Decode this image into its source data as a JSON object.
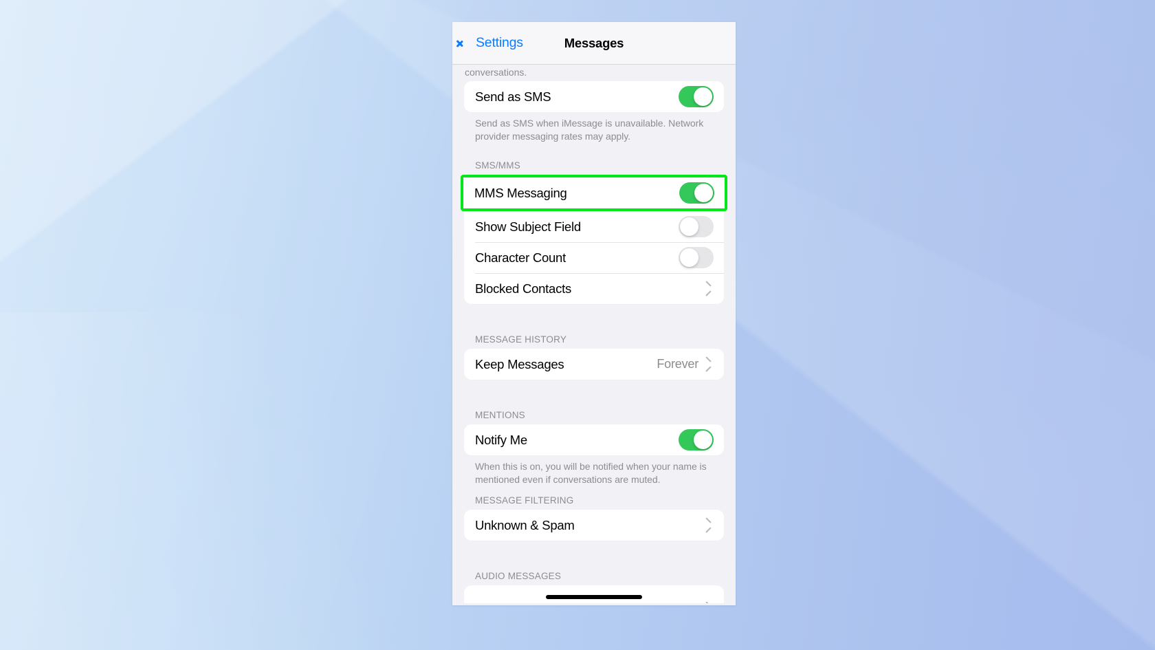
{
  "wallpaper": {
    "color_left": "#c6dff7",
    "color_right": "#a6bced"
  },
  "navbar": {
    "back_label": "Settings",
    "title": "Messages",
    "back_icon": "chevron-left-icon",
    "accent_color": "#0a7cff"
  },
  "clipped_text": "conversations.",
  "highlight": {
    "color": "#00e817",
    "target": "MMS Messaging"
  },
  "sections": [
    {
      "header": "",
      "rows": [
        {
          "label": "Send as SMS",
          "control": "toggle",
          "state": "on"
        }
      ],
      "footnote": "Send as SMS when iMessage is unavailable. Network provider messaging rates may apply."
    },
    {
      "header": "SMS/MMS",
      "rows": [
        {
          "label": "MMS Messaging",
          "control": "toggle",
          "state": "on",
          "highlighted": true
        },
        {
          "label": "Show Subject Field",
          "control": "toggle",
          "state": "off"
        },
        {
          "label": "Character Count",
          "control": "toggle",
          "state": "off"
        },
        {
          "label": "Blocked Contacts",
          "control": "chevron"
        }
      ],
      "footnote": ""
    },
    {
      "header": "MESSAGE HISTORY",
      "rows": [
        {
          "label": "Keep Messages",
          "value": "Forever",
          "control": "chevron"
        }
      ],
      "footnote": ""
    },
    {
      "header": "MENTIONS",
      "rows": [
        {
          "label": "Notify Me",
          "control": "toggle",
          "state": "on"
        }
      ],
      "footnote": "When this is on, you will be notified when your name is mentioned even if conversations are muted."
    },
    {
      "header": "MESSAGE FILTERING",
      "rows": [
        {
          "label": "Unknown & Spam",
          "control": "chevron"
        }
      ],
      "footnote": ""
    },
    {
      "header": "AUDIO MESSAGES",
      "rows": [
        {
          "label": "",
          "control": "chevron",
          "clipped": true
        }
      ],
      "footnote": ""
    }
  ],
  "colors": {
    "toggle_on": "#34c759",
    "toggle_off": "#e6e6e9",
    "page_background": "#f2f1f6",
    "card_background": "#ffffff",
    "secondary_text": "#8c8c92"
  }
}
